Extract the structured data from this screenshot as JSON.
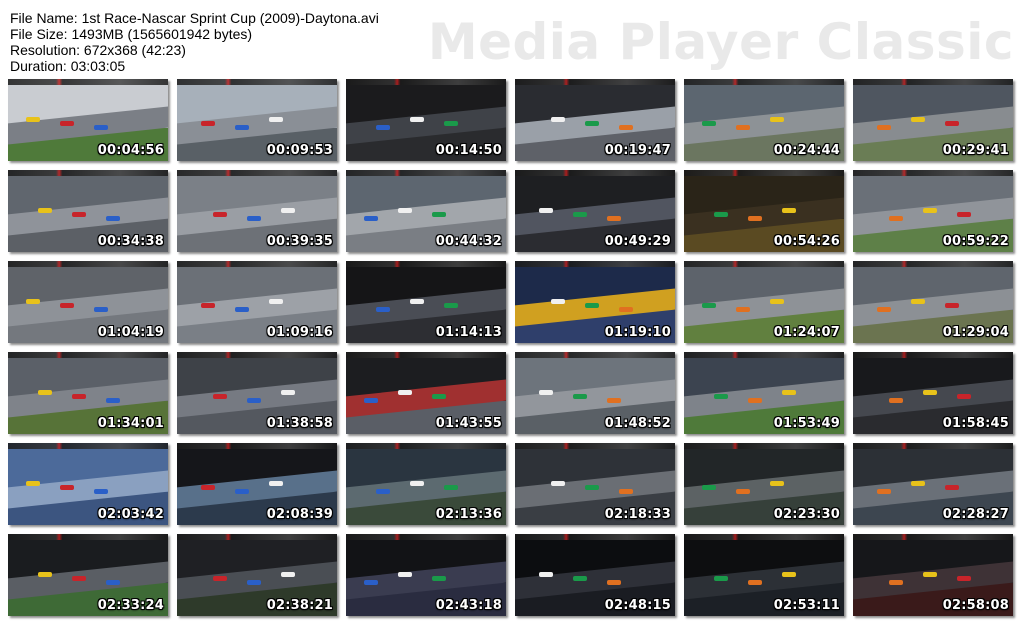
{
  "info": {
    "file_name": "File Name: 1st Race-Nascar Sprint Cup (2009)-Daytona.avi",
    "file_size": "File Size: 1493MB (1565601942 bytes)",
    "resolution": "Resolution: 672x368 (42:23)",
    "duration": "Duration: 03:03:05"
  },
  "watermark": "Media Player Classic",
  "thumbnails": [
    {
      "time": "00:04:56",
      "sky": "#c9ccd1",
      "ground": "#4f7a3a",
      "track": "#7b7f86"
    },
    {
      "time": "00:09:53",
      "sky": "#a7b0ba",
      "ground": "#596066",
      "track": "#8a8f96"
    },
    {
      "time": "00:14:50",
      "sky": "#1b1b1d",
      "ground": "#2a2b2e",
      "track": "#3f4248"
    },
    {
      "time": "00:19:47",
      "sky": "#2a2c31",
      "ground": "#5e6168",
      "track": "#9aa0a8"
    },
    {
      "time": "00:24:44",
      "sky": "#5c6670",
      "ground": "#6b7660",
      "track": "#8d9296"
    },
    {
      "time": "00:29:41",
      "sky": "#4f5660",
      "ground": "#6a7d55",
      "track": "#888c90"
    },
    {
      "time": "00:34:38",
      "sky": "#60666e",
      "ground": "#5c6066",
      "track": "#8f939a"
    },
    {
      "time": "00:39:35",
      "sky": "#7b8087",
      "ground": "#6d7177",
      "track": "#9a9ea4"
    },
    {
      "time": "00:44:32",
      "sky": "#5d6670",
      "ground": "#7a7e84",
      "track": "#a2a6ab"
    },
    {
      "time": "00:49:29",
      "sky": "#1e1f22",
      "ground": "#2b2c31",
      "track": "#515560"
    },
    {
      "time": "00:54:26",
      "sky": "#2a2418",
      "ground": "#5a4a22",
      "track": "#3a3020"
    },
    {
      "time": "00:59:22",
      "sky": "#6a7078",
      "ground": "#5e8048",
      "track": "#90949a"
    },
    {
      "time": "01:04:19",
      "sky": "#5f6369",
      "ground": "#74787e",
      "track": "#8e9298"
    },
    {
      "time": "01:09:16",
      "sky": "#6b7077",
      "ground": "#7a7f86",
      "track": "#9da1a7"
    },
    {
      "time": "01:14:13",
      "sky": "#151517",
      "ground": "#2d2e33",
      "track": "#4a4d55"
    },
    {
      "time": "01:19:10",
      "sky": "#1d2a4a",
      "ground": "#2f3f6b",
      "track": "#d0a020"
    },
    {
      "time": "01:24:07",
      "sky": "#5d636b",
      "ground": "#61803f",
      "track": "#8e9297"
    },
    {
      "time": "01:29:04",
      "sky": "#5f656d",
      "ground": "#6b7450",
      "track": "#8c9095"
    },
    {
      "time": "01:34:01",
      "sky": "#5b6068",
      "ground": "#577338",
      "track": "#7f838a"
    },
    {
      "time": "01:38:58",
      "sky": "#3e4248",
      "ground": "#54585f",
      "track": "#767a82"
    },
    {
      "time": "01:43:55",
      "sky": "#1c1d20",
      "ground": "#5a5e66",
      "track": "#a03030"
    },
    {
      "time": "01:48:52",
      "sky": "#6d747c",
      "ground": "#5a6066",
      "track": "#92969c"
    },
    {
      "time": "01:53:49",
      "sky": "#3c4450",
      "ground": "#4f7a3a",
      "track": "#7e838a"
    },
    {
      "time": "01:58:45",
      "sky": "#18191c",
      "ground": "#2a2b2f",
      "track": "#45484f"
    },
    {
      "time": "02:03:42",
      "sky": "#4c6a9a",
      "ground": "#3c5580",
      "track": "#8aa0c0"
    },
    {
      "time": "02:08:39",
      "sky": "#15161a",
      "ground": "#2c3a4c",
      "track": "#58708a"
    },
    {
      "time": "02:13:36",
      "sky": "#2a3540",
      "ground": "#3a4a3a",
      "track": "#5c6a70"
    },
    {
      "time": "02:18:33",
      "sky": "#2e3238",
      "ground": "#3a3e44",
      "track": "#6a6e74"
    },
    {
      "time": "02:23:30",
      "sky": "#222628",
      "ground": "#36403a",
      "track": "#5c6264"
    },
    {
      "time": "02:28:27",
      "sky": "#2c3036",
      "ground": "#3d4650",
      "track": "#6a7078"
    },
    {
      "time": "02:33:24",
      "sky": "#1a1c1f",
      "ground": "#3e6a36",
      "track": "#5a5e64"
    },
    {
      "time": "02:38:21",
      "sky": "#1f2024",
      "ground": "#2e3a2a",
      "track": "#4a4e54"
    },
    {
      "time": "02:43:18",
      "sky": "#121316",
      "ground": "#2a2c40",
      "track": "#3a3c50"
    },
    {
      "time": "02:48:15",
      "sky": "#0c0d10",
      "ground": "#1a1c22",
      "track": "#2e3038"
    },
    {
      "time": "02:53:11",
      "sky": "#0d0e10",
      "ground": "#1c2026",
      "track": "#2c3036"
    },
    {
      "time": "02:58:08",
      "sky": "#16171a",
      "ground": "#3a1a1a",
      "track": "#3e3236"
    }
  ]
}
